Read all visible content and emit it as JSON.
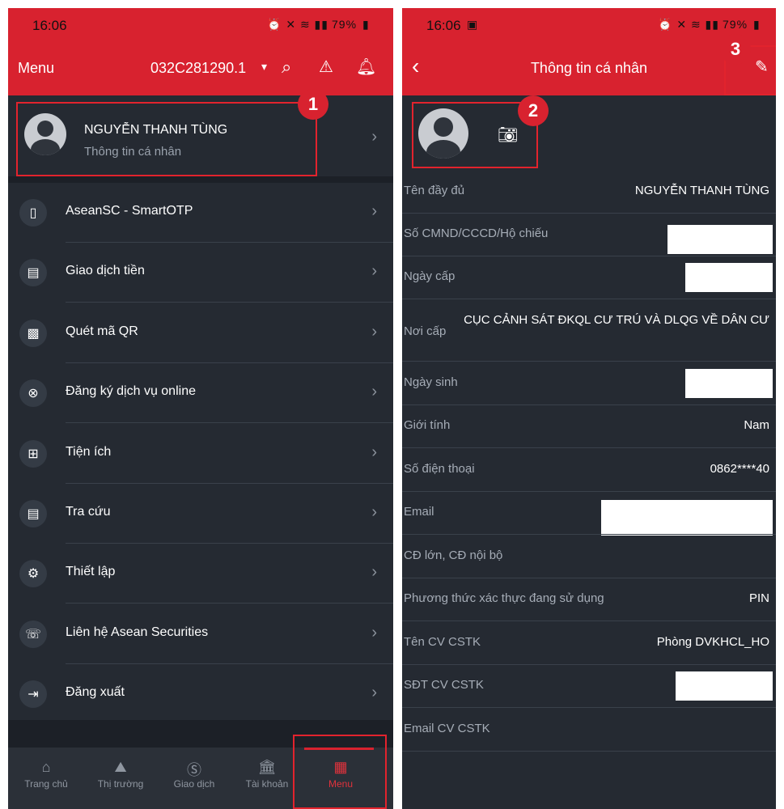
{
  "left": {
    "status": {
      "time": "16:06",
      "battery": "79%"
    },
    "header": {
      "title": "Menu",
      "account": "032C281290.1"
    },
    "profile": {
      "name": "NGUYỄN THANH TÙNG",
      "subtitle": "Thông tin cá nhân"
    },
    "menu_items": [
      {
        "label": "AseanSC - SmartOTP",
        "icon": "phone-icon"
      },
      {
        "label": "Giao dịch tiền",
        "icon": "wallet-icon"
      },
      {
        "label": "Quét mã QR",
        "icon": "qr-icon"
      },
      {
        "label": "Đăng ký dịch vụ online",
        "icon": "lifebuoy-icon"
      },
      {
        "label": "Tiện ích",
        "icon": "apps-icon"
      },
      {
        "label": "Tra cứu",
        "icon": "receipt-icon"
      },
      {
        "label": "Thiết lập",
        "icon": "gear-icon"
      },
      {
        "label": "Liên hệ Asean Securities",
        "icon": "call-icon"
      },
      {
        "label": "Đăng xuất",
        "icon": "logout-icon"
      }
    ],
    "nav": [
      {
        "label": "Trang chủ",
        "icon": "home-icon"
      },
      {
        "label": "Thị trường",
        "icon": "chart-icon"
      },
      {
        "label": "Giao dịch",
        "icon": "dollar-icon"
      },
      {
        "label": "Tài khoản",
        "icon": "bank-icon"
      },
      {
        "label": "Menu",
        "icon": "menu-grid-icon",
        "active": true
      }
    ],
    "annotations": {
      "b1": "1"
    }
  },
  "right": {
    "status": {
      "time": "16:06",
      "battery": "79%"
    },
    "header": {
      "title": "Thông tin cá nhân"
    },
    "annotations": {
      "b2": "2",
      "b3": "3"
    },
    "fields": [
      {
        "label": "Tên đầy đủ",
        "value": "NGUYỄN THANH TÙNG"
      },
      {
        "label": "Số CMND/CCCD/Hộ chiếu",
        "value": ""
      },
      {
        "label": "Ngày cấp",
        "value": ""
      },
      {
        "label": "Nơi cấp",
        "value": "CỤC CẢNH SÁT ĐKQL CƯ TRÚ VÀ DLQG VỀ DÂN CƯ"
      },
      {
        "label": "Ngày sinh",
        "value": ""
      },
      {
        "label": "Giới tính",
        "value": "Nam"
      },
      {
        "label": "Số điện thoại",
        "value": "0862****40"
      },
      {
        "label": "Email",
        "value": ""
      },
      {
        "label": "CĐ lớn, CĐ nội bộ",
        "value": ""
      },
      {
        "label": "Phương thức xác thực đang sử dụng",
        "value": "PIN"
      },
      {
        "label": "Tên CV CSTK",
        "value": "Phòng DVKHCL_HO"
      },
      {
        "label": "SĐT CV CSTK",
        "value": ""
      },
      {
        "label": "Email CV CSTK",
        "value": ""
      }
    ]
  },
  "colors": {
    "brand_red": "#d8222f",
    "background": "#252a32",
    "text": "#ffffff",
    "muted": "#9aa2ad"
  }
}
